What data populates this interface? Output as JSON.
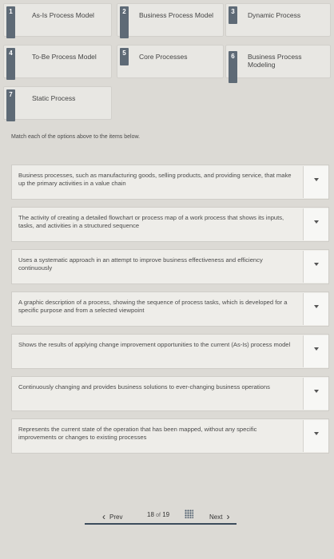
{
  "options": [
    {
      "number": "1",
      "label": "As-Is Process Model"
    },
    {
      "number": "2",
      "label": "Business Process Model"
    },
    {
      "number": "3",
      "label": "Dynamic Process"
    },
    {
      "number": "4",
      "label": "To-Be Process Model"
    },
    {
      "number": "5",
      "label": "Core Processes"
    },
    {
      "number": "6",
      "label": "Business Process Modeling"
    },
    {
      "number": "7",
      "label": "Static Process"
    }
  ],
  "instructions": "Match each of the options above to the items below.",
  "items": [
    {
      "text": "Business processes, such as manufacturing goods, selling products, and providing service, that make up the primary activities in a value chain"
    },
    {
      "text": "The activity of creating a detailed flowchart or process map of a work process that shows its inputs, tasks, and activities in a structured sequence"
    },
    {
      "text": "Uses a systematic approach in an attempt to improve business effectiveness and efficiency continuously"
    },
    {
      "text": "A graphic description of a process, showing the sequence of process tasks, which is developed for a specific purpose and from a selected viewpoint"
    },
    {
      "text": "Shows the results of applying change improvement opportunities to the current (As-Is) process model"
    },
    {
      "text": "Continuously changing and provides business solutions to ever-changing business operations"
    },
    {
      "text": "Represents the current state of the operation that has been mapped, without any specific improvements or changes to existing processes"
    }
  ],
  "pagination": {
    "prev_label": "Prev",
    "current": "18",
    "of_label": "of",
    "total": "19",
    "next_label": "Next"
  }
}
